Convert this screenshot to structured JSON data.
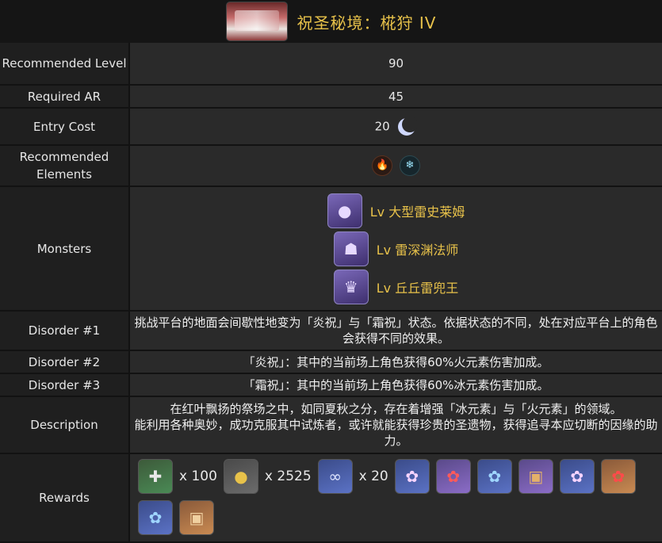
{
  "header": {
    "title": "祝圣秘境：椛狩 IV",
    "thumb_icon": "domain-preview-image"
  },
  "rows": {
    "recommended_level": {
      "label": "Recommended Level",
      "value": "90"
    },
    "required_ar": {
      "label": "Required AR",
      "value": "45"
    },
    "entry_cost": {
      "label": "Entry Cost",
      "value": "20",
      "icon": "original-resin-moon-icon"
    },
    "recommended_elements": {
      "label": "Recommended Elements",
      "icons": [
        "pyro-icon",
        "cryo-icon"
      ]
    },
    "monsters": {
      "label": "Monsters",
      "items": [
        {
          "name": "Lv 大型雷史莱姆",
          "icon": "large-electro-slime-icon"
        },
        {
          "name": "Lv 雷深渊法师",
          "icon": "electro-abyss-mage-icon"
        },
        {
          "name": "Lv 丘丘雷兜王",
          "icon": "thunderhelm-lawachurl-icon"
        }
      ]
    },
    "disorder1": {
      "label": "Disorder #1",
      "text": "挑战平台的地面会间歇性地变为「炎祝」与「霜祝」状态。依据状态的不同，处在对应平台上的角色会获得不同的效果。"
    },
    "disorder2": {
      "label": "Disorder #2",
      "text": "「炎祝」：其中的当前场上角色获得60%火元素伤害加成。"
    },
    "disorder3": {
      "label": "Disorder #3",
      "text": "「霜祝」：其中的当前场上角色获得60%冰元素伤害加成。"
    },
    "description": {
      "label": "Description",
      "line1": "在红叶飘扬的祭场之中，如同夏秋之分，存在着增强「冰元素」与「火元素」的领域。",
      "line2": "能利用各种奥妙，成功克服其中试炼者，或许就能获得珍贵的圣遗物，获得追寻本应切断的因缘的助力。"
    },
    "rewards": {
      "label": "Rewards",
      "items": [
        {
          "icon": "adventure-exp-icon",
          "qty": "x 100",
          "quality": "green"
        },
        {
          "icon": "mora-icon",
          "qty": "x 2525",
          "quality": "gold"
        },
        {
          "icon": "companionship-exp-icon",
          "qty": "x 20",
          "quality": "blue"
        },
        {
          "icon": "flower-artifact-icon",
          "qty": "",
          "quality": "blue"
        },
        {
          "icon": "flower-artifact-icon",
          "qty": "",
          "quality": "purple"
        },
        {
          "icon": "flower-artifact-icon",
          "qty": "",
          "quality": "blue"
        },
        {
          "icon": "sands-artifact-icon",
          "qty": "",
          "quality": "purple"
        },
        {
          "icon": "flower-artifact-icon",
          "qty": "",
          "quality": "blue"
        },
        {
          "icon": "flower-artifact-icon",
          "qty": "",
          "quality": "orange"
        },
        {
          "icon": "flower-artifact-icon",
          "qty": "",
          "quality": "blue"
        },
        {
          "icon": "sands-artifact-icon",
          "qty": "",
          "quality": "orange"
        }
      ]
    }
  }
}
